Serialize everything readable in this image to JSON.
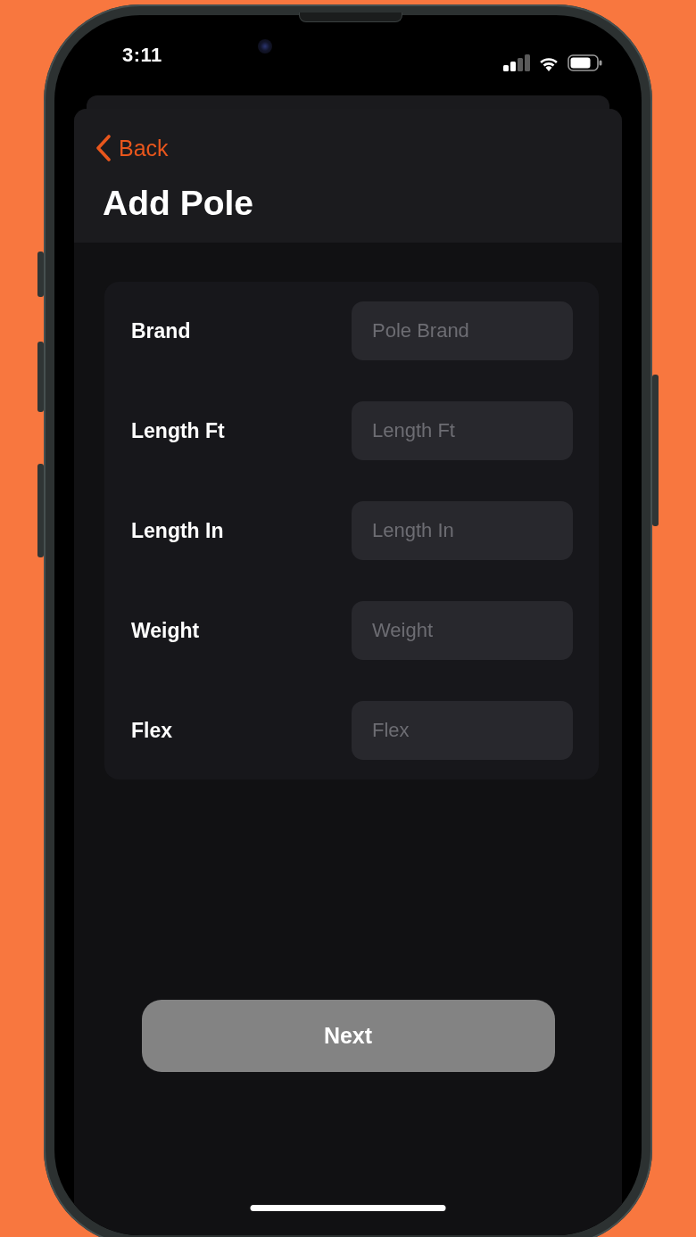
{
  "status_bar": {
    "time": "3:11"
  },
  "nav": {
    "back_label": "Back",
    "title": "Add Pole"
  },
  "form": {
    "rows": [
      {
        "label": "Brand",
        "placeholder": "Pole Brand"
      },
      {
        "label": "Length Ft",
        "placeholder": "Length Ft"
      },
      {
        "label": "Length In",
        "placeholder": "Length In"
      },
      {
        "label": "Weight",
        "placeholder": "Weight"
      },
      {
        "label": "Flex",
        "placeholder": "Flex"
      }
    ]
  },
  "next_button": {
    "label": "Next",
    "disabled": true
  }
}
